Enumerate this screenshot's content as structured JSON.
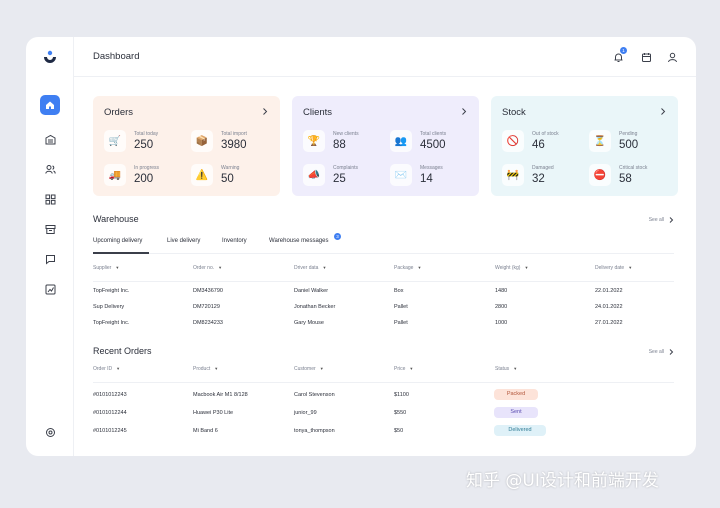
{
  "header": {
    "title": "Dashboard",
    "notification_count": "1"
  },
  "cards": [
    {
      "title": "Orders",
      "bg": "#fdf1ea",
      "stats": [
        {
          "label": "Total today",
          "value": "250",
          "icon": "cart-icon"
        },
        {
          "label": "Total import",
          "value": "3980",
          "icon": "box-icon"
        },
        {
          "label": "In progress",
          "value": "200",
          "icon": "truck-icon"
        },
        {
          "label": "Warning",
          "value": "50",
          "icon": "warning-icon"
        }
      ]
    },
    {
      "title": "Clients",
      "bg": "#efedfc",
      "stats": [
        {
          "label": "New clients",
          "value": "88",
          "icon": "trophy-icon"
        },
        {
          "label": "Total clients",
          "value": "4500",
          "icon": "people-icon"
        },
        {
          "label": "Complaints",
          "value": "25",
          "icon": "megaphone-icon"
        },
        {
          "label": "Messages",
          "value": "14",
          "icon": "mail-icon"
        }
      ]
    },
    {
      "title": "Stock",
      "bg": "#eaf6f9",
      "stats": [
        {
          "label": "Out of stock",
          "value": "46",
          "icon": "no-entry-icon"
        },
        {
          "label": "Pending",
          "value": "500",
          "icon": "hourglass-icon"
        },
        {
          "label": "Damaged",
          "value": "32",
          "icon": "damaged-box-icon"
        },
        {
          "label": "Critical stock",
          "value": "58",
          "icon": "alert-icon"
        }
      ]
    }
  ],
  "warehouse": {
    "title": "Warehouse",
    "see_all": "See all",
    "tabs": [
      "Upcoming delivery",
      "Live delivery",
      "Inventory",
      "Warehouse messages"
    ],
    "tab_badge": "3",
    "columns": [
      "Supplier",
      "Order no.",
      "Driver data",
      "Package",
      "Weight (kg)",
      "Delivery date"
    ],
    "rows": [
      [
        "TopFreight Inc.",
        "DM3436790",
        "Daniel Walker",
        "Box",
        "1480",
        "22.01.2022"
      ],
      [
        "Sup Delivery",
        "DM720129",
        "Jonathan Becker",
        "Pallet",
        "2800",
        "24.01.2022"
      ],
      [
        "TopFreight Inc.",
        "DM8234233",
        "Gary Mouse",
        "Pallet",
        "1000",
        "27.01.2022"
      ]
    ]
  },
  "recent_orders": {
    "title": "Recent Orders",
    "see_all": "See all",
    "columns": [
      "Order ID",
      "Product",
      "Customer",
      "Price",
      "Status"
    ],
    "rows": [
      {
        "id": "#0101012243",
        "product": "Macbook Air M1 8/128",
        "customer": "Carol Stevenson",
        "price": "$1100",
        "status": "Packed",
        "status_bg": "#fde3d9",
        "status_fg": "#b2553a"
      },
      {
        "id": "#0101012244",
        "product": "Huawei P30 Lite",
        "customer": "junior_99",
        "price": "$550",
        "status": "Sent",
        "status_bg": "#e8e4fb",
        "status_fg": "#5a4cb0"
      },
      {
        "id": "#0101012245",
        "product": "Mi Band 6",
        "customer": "tonya_thompson",
        "price": "$50",
        "status": "Delivered",
        "status_bg": "#dff1f8",
        "status_fg": "#2f7c95"
      }
    ]
  },
  "watermark": "知乎 @UI设计和前端开发",
  "colors": {
    "accent": "#3f7ff2",
    "background": "#e8eaf0"
  }
}
